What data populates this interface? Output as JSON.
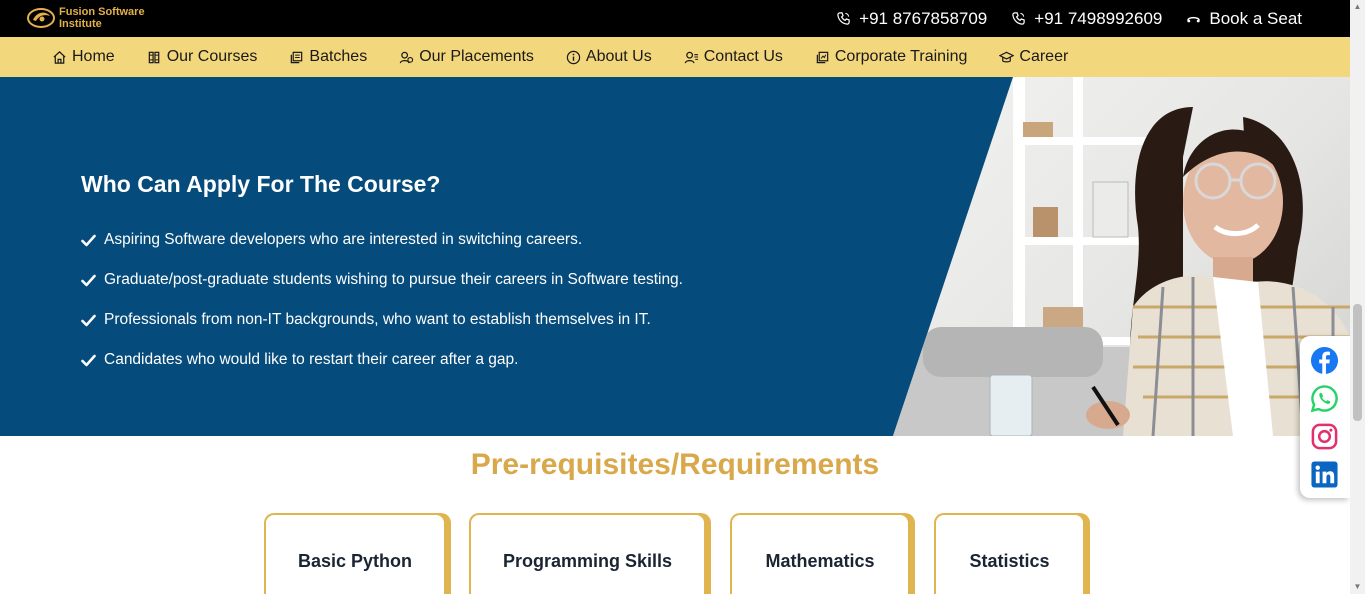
{
  "header": {
    "logo_text": "Fusion Software Institute",
    "contacts": [
      {
        "icon": "phone-icon",
        "label": "+91 8767858709"
      },
      {
        "icon": "phone-icon",
        "label": "+91 7498992609"
      },
      {
        "icon": "seat-icon",
        "label": "Book a Seat"
      }
    ]
  },
  "nav": {
    "items": [
      {
        "icon": "home-icon",
        "label": "Home"
      },
      {
        "icon": "books-icon",
        "label": "Our Courses"
      },
      {
        "icon": "batches-icon",
        "label": "Batches"
      },
      {
        "icon": "placements-icon",
        "label": "Our Placements"
      },
      {
        "icon": "info-icon",
        "label": "About Us"
      },
      {
        "icon": "contact-icon",
        "label": "Contact Us"
      },
      {
        "icon": "corporate-icon",
        "label": "Corporate Training"
      },
      {
        "icon": "graduation-cap-icon",
        "label": "Career"
      }
    ]
  },
  "hero": {
    "title": "Who Can Apply For The Course?",
    "bullets": [
      "Aspiring Software developers who are interested in switching careers.",
      "Graduate/post-graduate students wishing to pursue their careers in Software testing.",
      "Professionals from non-IT backgrounds, who want to establish themselves in IT.",
      "Candidates who would like to restart their career after a gap."
    ]
  },
  "requirements": {
    "title": "Pre-requisites/Requirements",
    "cards": [
      "Basic Python",
      "Programming Skills",
      "Mathematics",
      "Statistics"
    ]
  },
  "social": [
    "facebook-icon",
    "whatsapp-icon",
    "instagram-icon",
    "linkedin-icon"
  ],
  "colors": {
    "top_bar": "#000000",
    "nav_bar": "#f3d77c",
    "hero_bg": "#054b7c",
    "accent_gold": "#d9a84a"
  }
}
